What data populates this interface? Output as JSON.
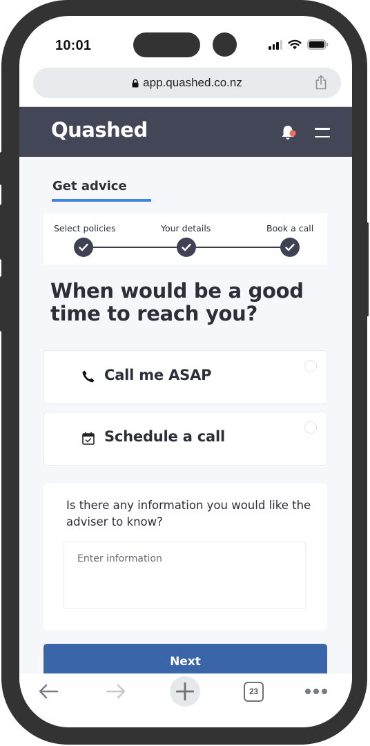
{
  "status_bar": {
    "time": "10:01",
    "icons": [
      "cellular-signal-icon",
      "wifi-icon",
      "battery-icon"
    ]
  },
  "browser": {
    "url": "app.quashed.co.nz",
    "lock_icon": "lock-icon",
    "share_icon": "share-icon",
    "bottom_bar": {
      "back_icon": "arrow-left-icon",
      "forward_icon": "arrow-right-icon",
      "new_tab_icon": "plus-icon",
      "tabs_count": "23",
      "more_icon": "more-dots-icon"
    }
  },
  "header": {
    "logo": "Quashed",
    "notification_icon": "bell-icon",
    "notification_badge_color": "#e8705f",
    "menu_icon": "hamburger-menu-icon",
    "background_color": "#434656"
  },
  "page": {
    "tab_label": "Get advice",
    "accent_color": "#3c82e8",
    "stepper": {
      "steps": [
        {
          "label": "Select policies",
          "status": "complete"
        },
        {
          "label": "Your details",
          "status": "complete"
        },
        {
          "label": "Book a call",
          "status": "complete"
        }
      ]
    },
    "question": "When would be a good time to reach you?",
    "options": [
      {
        "label": "Call me ASAP",
        "icon": "phone-icon",
        "selected": false
      },
      {
        "label": "Schedule a call",
        "icon": "calendar-check-icon",
        "selected": false
      }
    ],
    "info": {
      "label": "Is there any information you would like the adviser to know?",
      "placeholder": "Enter information",
      "value": ""
    },
    "next_button": {
      "label": "Next",
      "color": "#3b65a9"
    }
  }
}
